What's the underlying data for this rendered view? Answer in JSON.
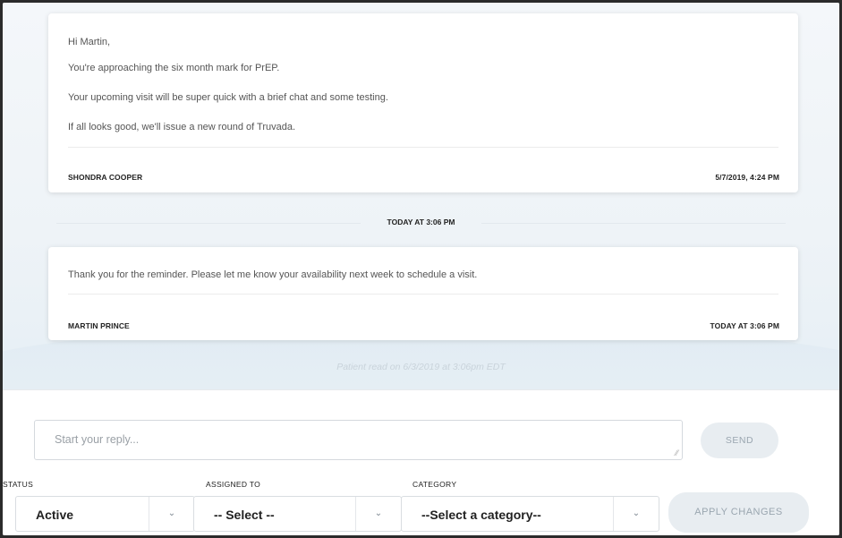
{
  "messages": [
    {
      "lines": [
        "Hi Martin,",
        "You're approaching the six month mark for PrEP.",
        "Your upcoming visit will be super quick with a brief chat and some testing.",
        "If all looks good, we'll issue a new round of Truvada."
      ],
      "author": "SHONDRA COOPER",
      "timestamp": "5/7/2019, 4:24 PM"
    },
    {
      "lines": [
        "Thank you for the reminder. Please let me know your availability next week to schedule a visit."
      ],
      "author": "MARTIN PRINCE",
      "timestamp": "TODAY AT 3:06 PM"
    }
  ],
  "separator": "TODAY AT 3:06 PM",
  "read_receipt": "Patient read on 6/3/2019 at 3:06pm EDT",
  "composer": {
    "reply_placeholder": "Start your reply...",
    "send_label": "SEND",
    "status_label": "STATUS",
    "status_value": "Active",
    "assigned_label": "ASSIGNED TO",
    "assigned_value": "-- Select --",
    "category_label": "CATEGORY",
    "category_value": "--Select a category--",
    "apply_label": "APPLY CHANGES"
  },
  "icons": {
    "chevron": "chevron-down-icon",
    "resize": "resize-grip-icon"
  }
}
